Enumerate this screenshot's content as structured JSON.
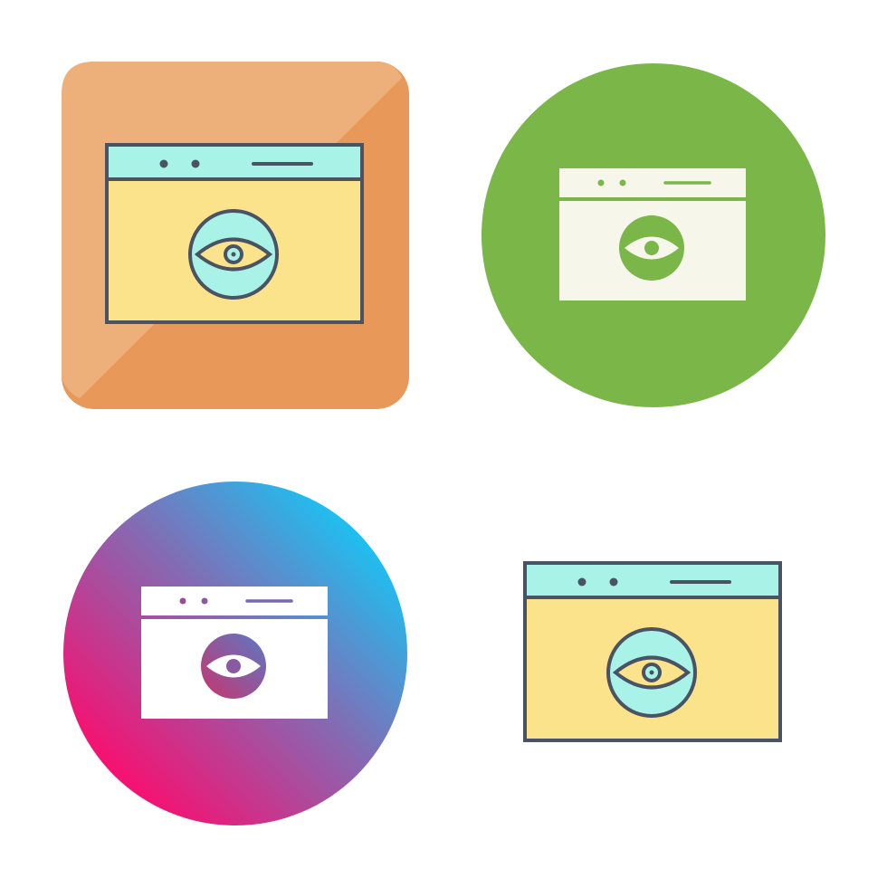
{
  "icons": [
    {
      "name": "browser-eye-icon",
      "style": "filled-outline",
      "container": "rounded-square",
      "colors": {
        "container": "#E8995A",
        "container_highlight": "#EEB07A",
        "stroke": "#4A5363",
        "window_bar": "#A8F2E8",
        "window_body": "#FBE38C",
        "eye_circle": "#A8F2E8",
        "eye": "#FBE38C"
      }
    },
    {
      "name": "browser-eye-icon",
      "style": "glyph",
      "container": "circle",
      "colors": {
        "container": "#7AB648",
        "glyph": "#F6F7EA",
        "eye_circle": "#7AB648"
      }
    },
    {
      "name": "browser-eye-icon",
      "style": "glyph",
      "container": "gradient-circle",
      "colors": {
        "gradient_start": "#FF0A6C",
        "gradient_end": "#16C6F5",
        "glyph": "#FFFFFF"
      }
    },
    {
      "name": "browser-eye-icon",
      "style": "filled-outline",
      "container": "none",
      "colors": {
        "stroke": "#4A5363",
        "window_bar": "#A8F2E8",
        "window_body": "#FBE38C",
        "eye_circle": "#A8F2E8",
        "eye": "#FBE38C"
      }
    }
  ]
}
